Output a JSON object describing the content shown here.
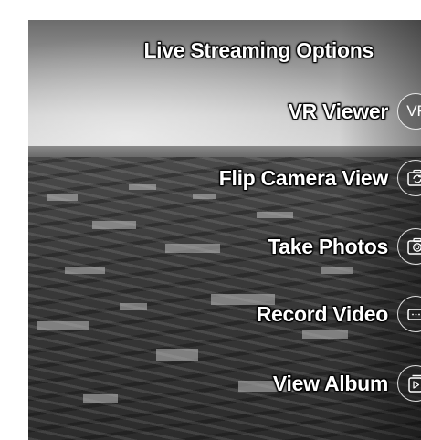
{
  "menu": {
    "title": "Live Streaming Options",
    "items": [
      {
        "id": "vr-viewer",
        "label": "VR Viewer",
        "icon": "vr-icon",
        "icon_text": "VR"
      },
      {
        "id": "flip-camera-view",
        "label": "Flip Camera View",
        "icon": "flip-camera-icon"
      },
      {
        "id": "take-photos",
        "label": "Take Photos",
        "icon": "camera-icon"
      },
      {
        "id": "record-video",
        "label": "Record Video",
        "icon": "video-camera-icon"
      },
      {
        "id": "view-album",
        "label": "View Album",
        "icon": "album-icon"
      }
    ]
  },
  "colors": {
    "text": "#ffffff",
    "outline": "#000000"
  }
}
